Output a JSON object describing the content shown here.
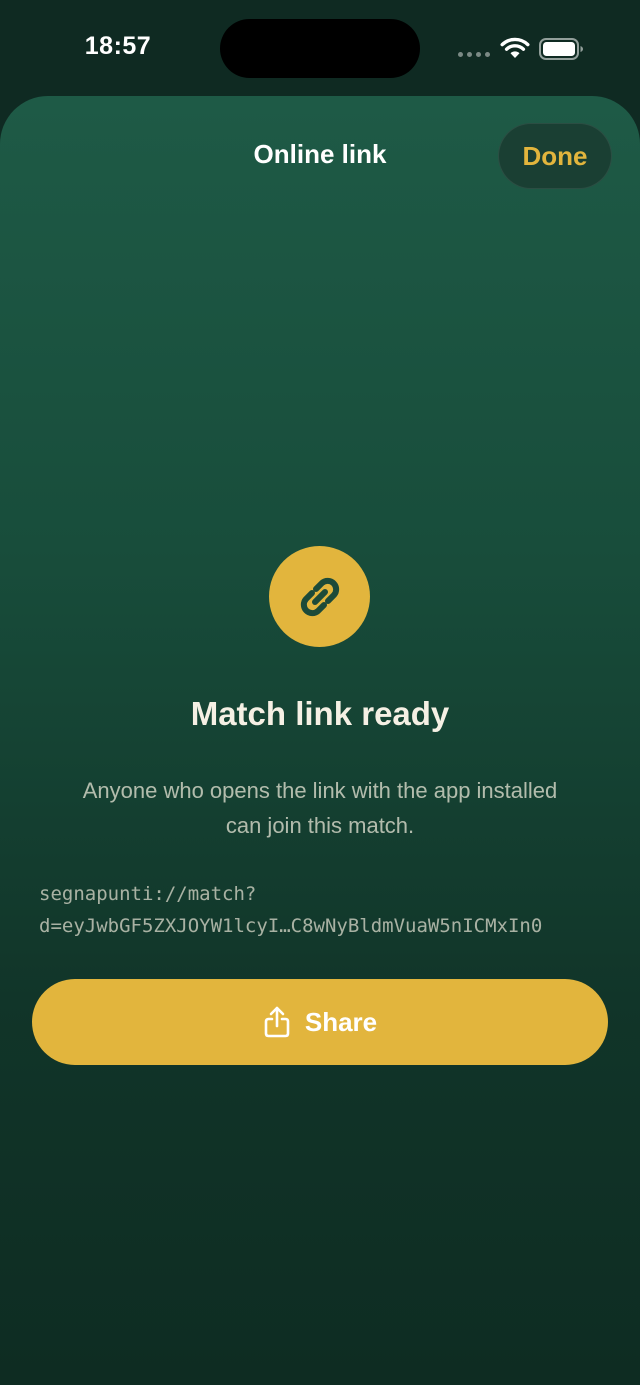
{
  "status_bar": {
    "time": "18:57"
  },
  "header": {
    "title": "Online link",
    "done_label": "Done"
  },
  "content": {
    "icon": "link-icon",
    "heading": "Match link ready",
    "description_line1": "Anyone who opens the link with the app installed",
    "description_line2": "can join this match.",
    "link_line1": "segnapunti://match?",
    "link_line2": "d=eyJwbGF5ZXJOYW1lcyI…C8wNyBldmVuaW5nICMxIn0"
  },
  "actions": {
    "share_icon": "share-icon",
    "share_label": "Share"
  },
  "colors": {
    "accent": "#e2b53d",
    "background_top": "#1e5a46",
    "background_bottom": "#0e2c22",
    "text_primary": "#f5f0e4"
  }
}
